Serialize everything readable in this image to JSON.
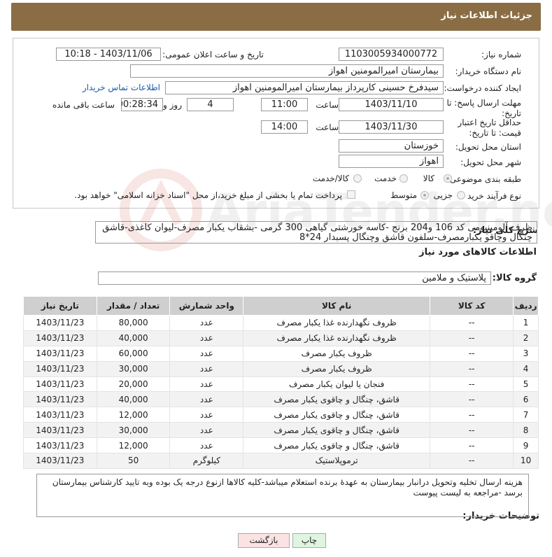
{
  "header_title": "جزئیات اطلاعات نیاز",
  "fields": {
    "need_number_label": "شماره نیاز:",
    "need_number": "1103005934000772",
    "announce_label": "تاریخ و ساعت اعلان عمومی:",
    "announce_value": "1403/11/06 - 10:18",
    "buyer_org_label": "نام دستگاه خریدار:",
    "buyer_org": "بیمارستان امیرالمومنین اهواز",
    "creator_label": "ایجاد کننده درخواست:",
    "creator": "سیدفرخ حسینی کارپرداز بیمارستان امیرالمومنین اهواز",
    "contact_link": "اطلاعات تماس خریدار",
    "deadline_label": "مهلت ارسال پاسخ: تا تاریخ:",
    "deadline_date": "1403/11/10",
    "time_label": "ساعت",
    "deadline_time": "11:00",
    "days_value": "4",
    "days_label": "روز و",
    "remaining_time": "00:28:34",
    "remaining_label": "ساعت باقی مانده",
    "price_validity_label": "حداقل تاریخ اعتبار قیمت: تا تاریخ:",
    "price_validity_date": "1403/11/30",
    "price_validity_time": "14:00",
    "province_label": "استان محل تحویل:",
    "province": "خوزستان",
    "city_label": "شهر محل تحویل:",
    "city": "اهواز",
    "category_label": "طبقه بندی موضوعی:",
    "category_options": [
      "کالا",
      "خدمت",
      "کالا/خدمت"
    ],
    "process_label": "نوع فرآیند خرید :",
    "process_options": [
      "جزیی",
      "متوسط"
    ],
    "payment_note": "پرداخت تمام یا بخشی از مبلغ خرید،از محل \"اسناد خزانه اسلامی\" خواهد بود."
  },
  "general_description_label": "شرح کلی نیاز:",
  "general_description": "ظرف آلومینیومی کد 106 و204 برنج -کاسه خورشتی گیاهی 300 گرمی -بشقاب یکبار مصرف-لیوان کاغذی-قاشق چنگال وچاقو یکبارمصرف-سلفون قاشق وچنگال پسبدار 24*8",
  "goods_info_title": "اطلاعات کالاهای مورد نیاز",
  "goods_group_label": "گروه کالا:",
  "goods_group": "پلاستیک و ملامین",
  "table": {
    "headers": [
      "ردیف",
      "کد کالا",
      "نام کالا",
      "واحد شمارش",
      "تعداد / مقدار",
      "تاریخ نیاز"
    ],
    "rows": [
      [
        "1",
        "--",
        "ظروف نگهدارنده غذا یکبار مصرف",
        "عدد",
        "80,000",
        "1403/11/23"
      ],
      [
        "2",
        "--",
        "ظروف نگهدارنده غذا یکبار مصرف",
        "عدد",
        "40,000",
        "1403/11/23"
      ],
      [
        "3",
        "--",
        "ظروف یکبار مصرف",
        "عدد",
        "60,000",
        "1403/11/23"
      ],
      [
        "4",
        "--",
        "ظروف یکبار مصرف",
        "عدد",
        "30,000",
        "1403/11/23"
      ],
      [
        "5",
        "--",
        "فنجان یا لیوان یکبار مصرف",
        "عدد",
        "20,000",
        "1403/11/23"
      ],
      [
        "6",
        "--",
        "قاشق، چنگال و چاقوی یکبار مصرف",
        "عدد",
        "40,000",
        "1403/11/23"
      ],
      [
        "7",
        "--",
        "قاشق، چنگال و چاقوی یکبار مصرف",
        "عدد",
        "12,000",
        "1403/11/23"
      ],
      [
        "8",
        "--",
        "قاشق، چنگال و چاقوی یکبار مصرف",
        "عدد",
        "30,000",
        "1403/11/23"
      ],
      [
        "9",
        "--",
        "قاشق، چنگال و چاقوی یکبار مصرف",
        "عدد",
        "12,000",
        "1403/11/23"
      ],
      [
        "10",
        "--",
        "ترموپلاستیک",
        "کیلوگرم",
        "50",
        "1403/11/23"
      ]
    ]
  },
  "buyer_notes_label": "توضیحات خریدار:",
  "buyer_notes": "هزینه ارسال تخلیه وتحویل درانبار بیمارستان به عهدهٔ برنده استعلام میباشد-کلیه کالاها ازنوع درجه یک بوده وبه تایید کارشناس بیمارستان برسد -مراجعه به لیست پیوست",
  "buttons": {
    "print": "چاپ",
    "back": "بازگشت"
  },
  "watermark_text": "AriaTender.neT"
}
